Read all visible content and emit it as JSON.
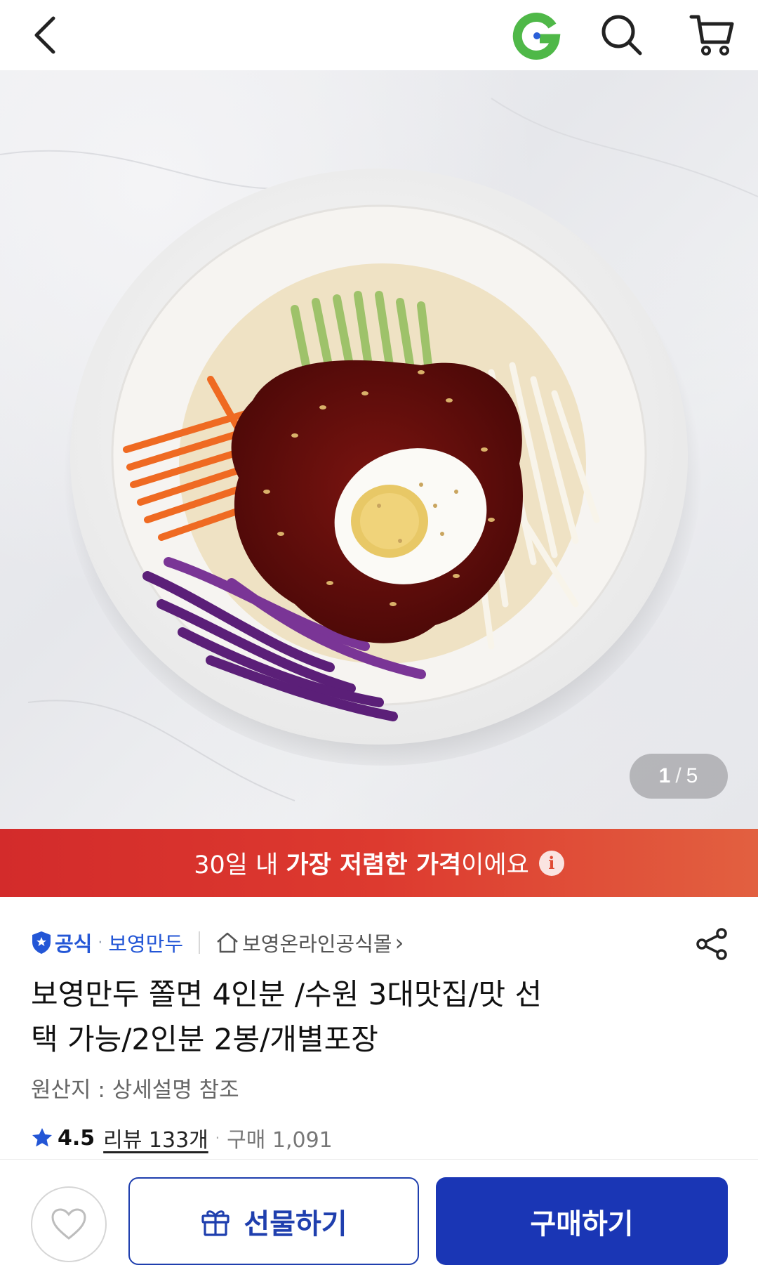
{
  "header": {
    "back_icon": "chevron-left-icon",
    "brand_icon": "gmarket-g-logo",
    "search_icon": "search-icon",
    "cart_icon": "cart-icon"
  },
  "hero": {
    "pager_current": "1",
    "pager_separator": "/",
    "pager_total": "5"
  },
  "banner": {
    "prefix": "30일 내 ",
    "highlight": "가장 저렴한 가격",
    "suffix": "이에요",
    "info_glyph": "i"
  },
  "seller": {
    "official_label": "공식",
    "brand_name": "보영만두",
    "store_name": "보영온라인공식몰",
    "store_chevron": "›"
  },
  "product": {
    "title_line1": "보영만두 쫄면 4인분 /수원 3대맛집/맛 선",
    "title_line2": "택 가능/2인분 2봉/개별포장",
    "origin": "원산지 : 상세설명 참조"
  },
  "rating": {
    "value": "4.5",
    "review_label": "리뷰 133개",
    "purchase_label": "구매 1,091"
  },
  "actions": {
    "gift_label": "선물하기",
    "buy_label": "구매하기"
  },
  "colors": {
    "brand_blue": "#1a36b5",
    "official_blue": "#2356d6",
    "banner_red": "#d32b2b",
    "gmarket_green": "#4fb848"
  }
}
